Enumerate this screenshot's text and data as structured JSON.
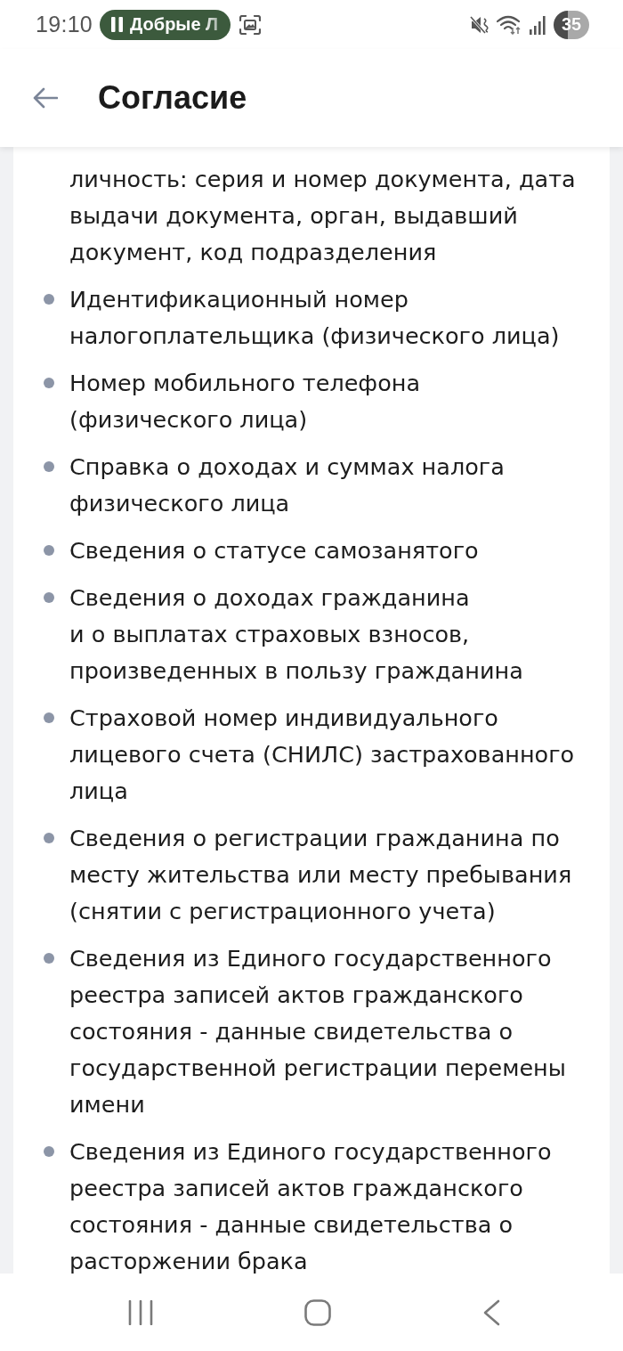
{
  "status_bar": {
    "time": "19:10",
    "media_chip": {
      "title": "Добрые Л",
      "playing": true
    },
    "battery": {
      "percent": "35"
    }
  },
  "header": {
    "title": "Согласие"
  },
  "list": {
    "items": [
      {
        "kind": "continued",
        "text": "личность: серия и номер документа, дата выдачи документа, орган, выдавший документ, код подразделения"
      },
      {
        "kind": "bullet",
        "text": "Идентификационный номер налогоплательщика (физического лица)"
      },
      {
        "kind": "bullet",
        "text": "Номер мобильного телефона (физического лица)"
      },
      {
        "kind": "bullet",
        "text": "Справка о доходах и суммах налога физического лица"
      },
      {
        "kind": "bullet",
        "text": "Сведения о статусе самозанятого"
      },
      {
        "kind": "bullet",
        "text": "Сведения о доходах гражданина и о выплатах страховых взносов, произведенных в пользу гражданина"
      },
      {
        "kind": "bullet",
        "text": "Страховой номер индивидуального лицевого счета (СНИЛС) застрахованного лица"
      },
      {
        "kind": "bullet",
        "text": "Сведения о регистрации гражданина по месту жительства или месту пребывания (снятии с регистрационного учета)"
      },
      {
        "kind": "bullet",
        "text": "Сведения из Единого государственного реестра записей актов гражданского состояния - данные свидетельства о государственной регистрации перемены имени"
      },
      {
        "kind": "bullet",
        "text": "Сведения из Единого государственного реестра записей актов гражданского состояния - данные свидетельства о расторжении брака"
      }
    ]
  }
}
